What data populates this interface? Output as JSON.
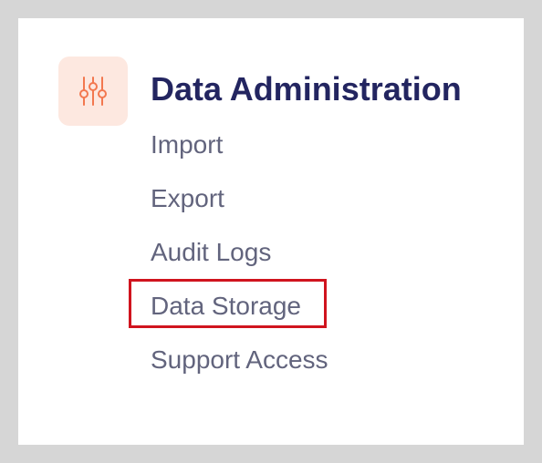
{
  "section": {
    "title": "Data Administration",
    "icon": "sliders-icon",
    "icon_color": "#f3784f",
    "icon_bg": "#fde8e0"
  },
  "menu": {
    "items": [
      {
        "label": "Import"
      },
      {
        "label": "Export"
      },
      {
        "label": "Audit Logs"
      },
      {
        "label": "Data Storage",
        "highlighted": true
      },
      {
        "label": "Support Access"
      }
    ]
  },
  "highlight_color": "#d0141e"
}
